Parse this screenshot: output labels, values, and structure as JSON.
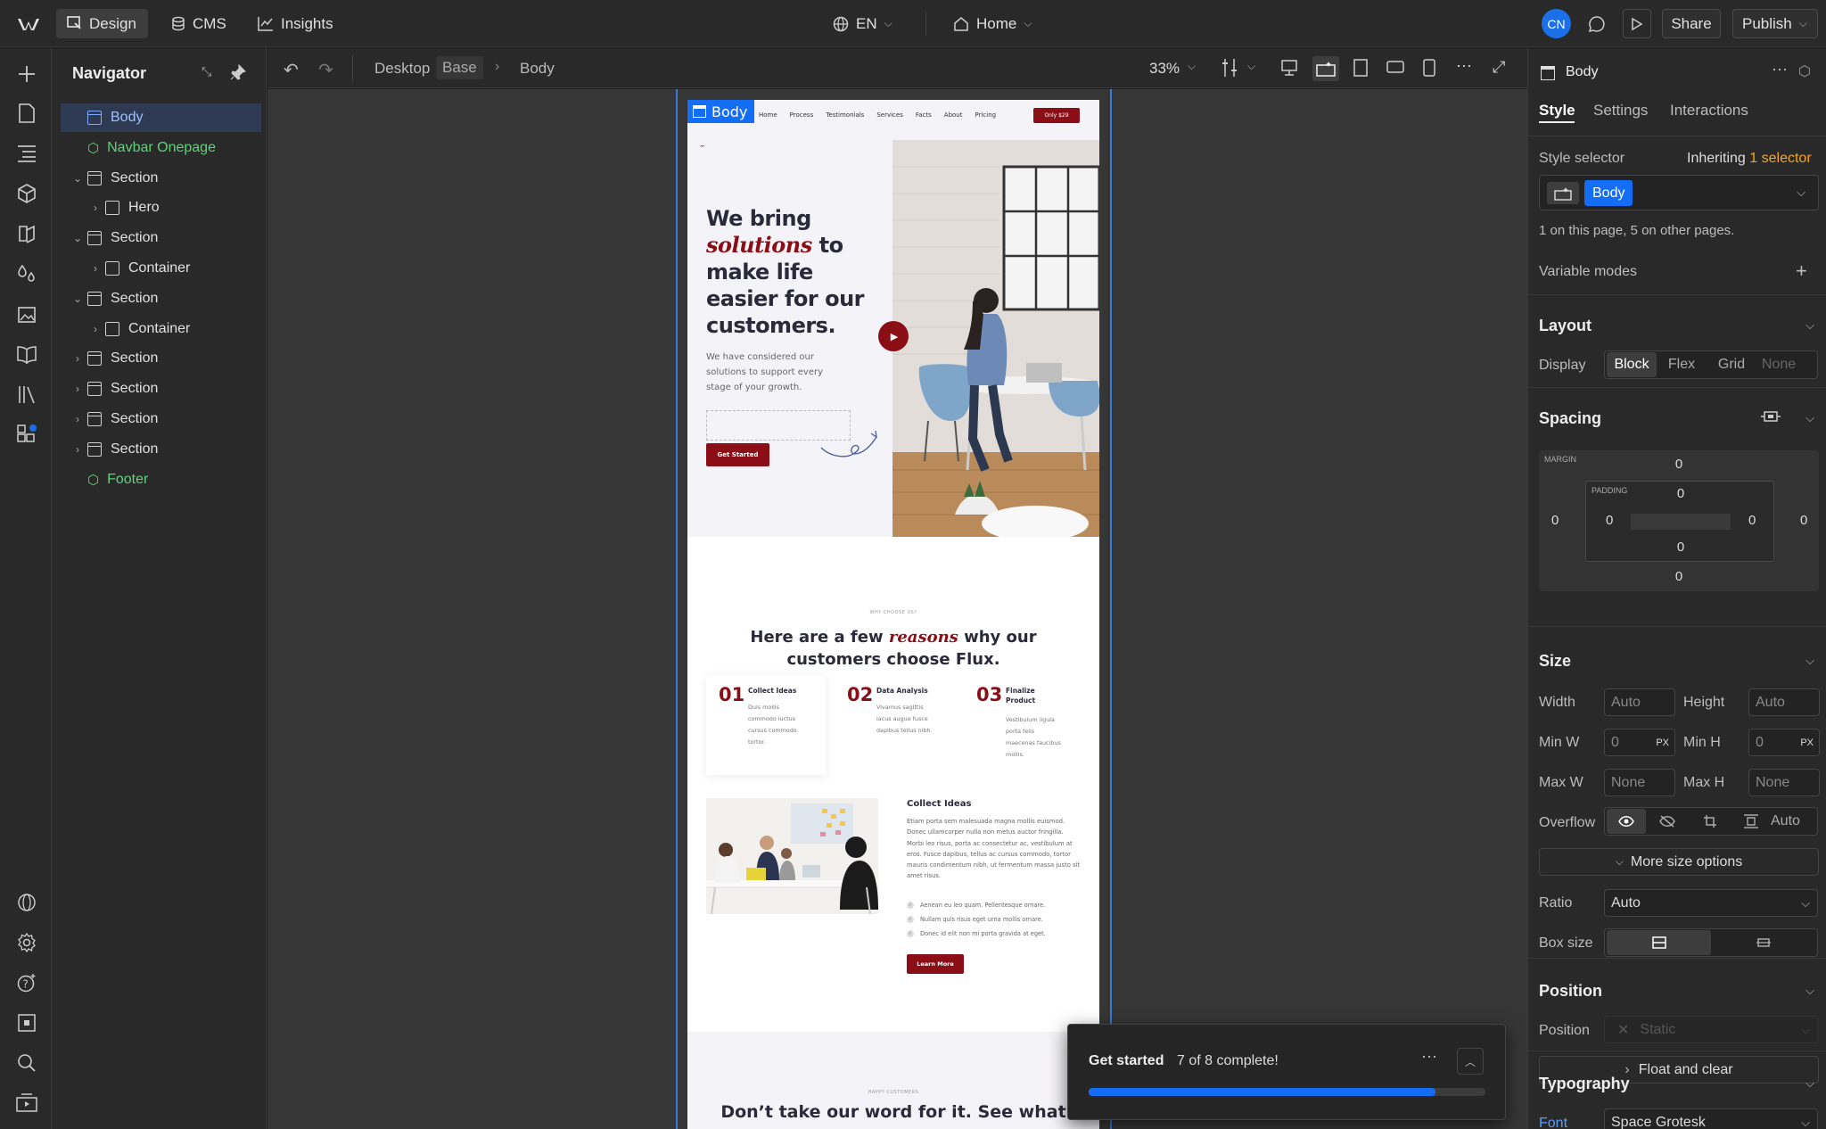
{
  "topbar": {
    "tabs": [
      {
        "label": "Design",
        "icon": "design-icon"
      },
      {
        "label": "CMS",
        "icon": "database-icon"
      },
      {
        "label": "Insights",
        "icon": "chart-icon"
      }
    ],
    "locale": "EN",
    "page": "Home",
    "avatar": "CN",
    "share": "Share",
    "publish": "Publish"
  },
  "navigator": {
    "title": "Navigator",
    "items": [
      {
        "label": "Body",
        "indent": 0,
        "type": "body",
        "caret": ""
      },
      {
        "label": "Navbar Onepage",
        "indent": 0,
        "type": "component",
        "caret": ""
      },
      {
        "label": "Section",
        "indent": 0,
        "type": "box",
        "caret": "open"
      },
      {
        "label": "Hero",
        "indent": 1,
        "type": "box",
        "caret": "closed"
      },
      {
        "label": "Section",
        "indent": 0,
        "type": "box",
        "caret": "open"
      },
      {
        "label": "Container",
        "indent": 1,
        "type": "box",
        "caret": "closed"
      },
      {
        "label": "Section",
        "indent": 0,
        "type": "box",
        "caret": "open"
      },
      {
        "label": "Container",
        "indent": 1,
        "type": "box",
        "caret": "closed"
      },
      {
        "label": "Section",
        "indent": 0,
        "type": "box",
        "caret": "closed"
      },
      {
        "label": "Section",
        "indent": 0,
        "type": "box",
        "caret": "closed"
      },
      {
        "label": "Section",
        "indent": 0,
        "type": "box",
        "caret": "closed"
      },
      {
        "label": "Section",
        "indent": 0,
        "type": "box",
        "caret": "closed"
      },
      {
        "label": "Footer",
        "indent": 0,
        "type": "component",
        "caret": ""
      }
    ]
  },
  "canvasbar": {
    "breakpoint": "Desktop",
    "variant": "Base",
    "crumb": "Body",
    "zoom": "33%"
  },
  "site": {
    "body_tag": "Body",
    "nav": [
      "Home",
      "Process",
      "Testimonials",
      "Services",
      "Facts",
      "About",
      "Pricing"
    ],
    "nav_cta": "Only $29",
    "hero_title_1": "We bring",
    "hero_title_em": "solutions",
    "hero_title_2": "to make life easier for our customers.",
    "hero_sub": "We have considered our solutions to support every stage of your growth.",
    "hero_btn": "Get Started",
    "why_eyebrow": "WHY CHOOSE US?",
    "why_title_1": "Here are a few",
    "why_title_em": "reasons",
    "why_title_2": "why our customers choose Flux.",
    "features": [
      {
        "num": "01",
        "title": "Collect Ideas",
        "text": "Duis mollis commodo luctus cursus commodo tortor."
      },
      {
        "num": "02",
        "title": "Data Analysis",
        "text": "Vivamus sagittis lacus augue fusce dapibus tellus nibh."
      },
      {
        "num": "03",
        "title": "Finalize Product",
        "text": "Vestibulum ligula porta felis maecenas faucibus mollis."
      }
    ],
    "collect_title": "Collect Ideas",
    "collect_text": "Etiam porta sem malesuada magna mollis euismod. Donec ullamcorper nulla non metus auctor fringilla. Morbi leo risus, porta ac consectetur ac, vestibulum at eros. Fusce dapibus, tellus ac cursus commodo, tortor mauris condimentum nibh, ut fermentum massa justo sit amet risus.",
    "checks": [
      "Aenean eu leo quam. Pellentesque ornare.",
      "Nullam quis risus eget urna mollis ornare.",
      "Donec id elit non mi porta gravida at eget."
    ],
    "learn_more": "Learn More",
    "happy_eyebrow": "HAPPY CUSTOMERS",
    "testi_title": "Don’t take our word for it. See what"
  },
  "panel": {
    "element": "Body",
    "tabs": [
      "Style",
      "Settings",
      "Interactions"
    ],
    "style_selector": "Style selector",
    "inheriting": "Inheriting",
    "inheriting_count": "1 selector",
    "selector_chip": "Body",
    "usage": "1 on this page, 5 on other pages.",
    "variable_modes": "Variable modes",
    "layout": {
      "title": "Layout",
      "display_label": "Display",
      "options": [
        "Block",
        "Flex",
        "Grid",
        "None"
      ]
    },
    "spacing": {
      "title": "Spacing",
      "margin_label": "MARGIN",
      "padding_label": "PADDING",
      "margin": [
        "0",
        "0",
        "0",
        "0"
      ],
      "padding": [
        "0",
        "0",
        "0",
        "0"
      ]
    },
    "size": {
      "title": "Size",
      "width_label": "Width",
      "width": "Auto",
      "height_label": "Height",
      "height": "Auto",
      "minw_label": "Min W",
      "minw": "0",
      "minw_unit": "PX",
      "minh_label": "Min H",
      "minh": "0",
      "minh_unit": "PX",
      "maxw_label": "Max W",
      "maxw": "None",
      "maxh_label": "Max H",
      "maxh": "None",
      "overflow_label": "Overflow",
      "overflow_auto": "Auto",
      "more": "More size options",
      "ratio_label": "Ratio",
      "ratio": "Auto",
      "boxsize_label": "Box size"
    },
    "position": {
      "title": "Position",
      "label": "Position",
      "value": "Static",
      "float": "Float and clear"
    },
    "typography": {
      "title": "Typography",
      "font_label": "Font",
      "font": "Space Grotesk"
    }
  },
  "toast": {
    "title": "Get started",
    "progress_text": "7 of 8 complete!",
    "progress": 0.875
  },
  "colors": {
    "accent": "#146ef5",
    "brand": "#8b0e16",
    "component": "#5fd37a",
    "inherit": "#f5a623"
  }
}
